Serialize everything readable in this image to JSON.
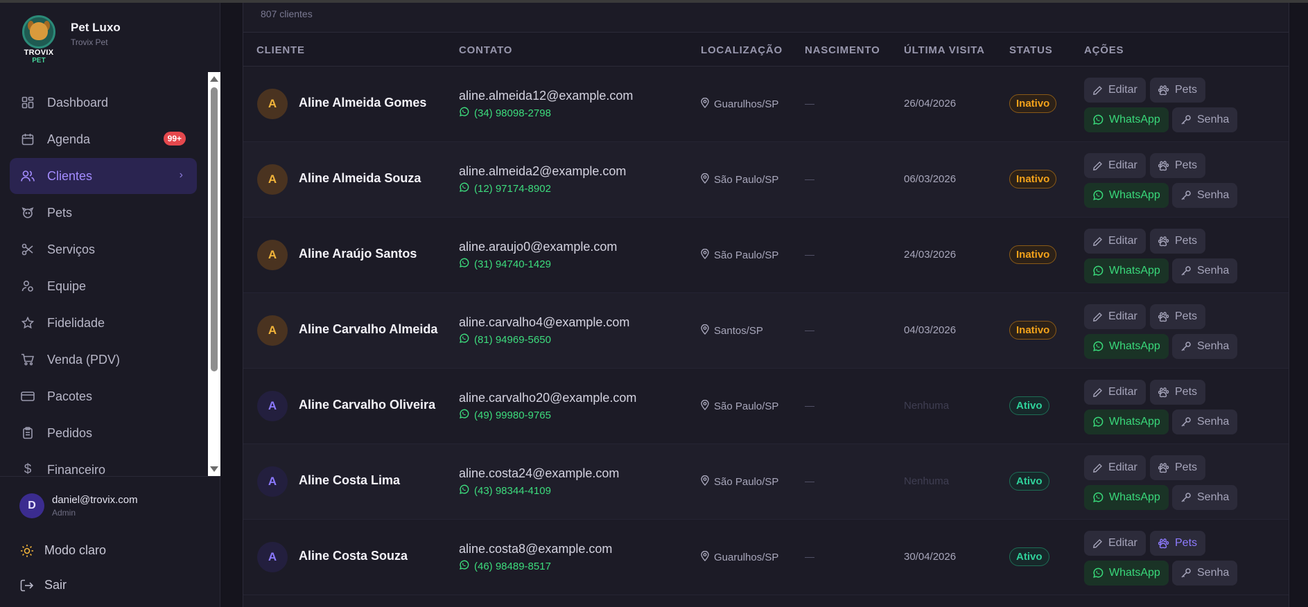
{
  "brand": {
    "name": "Pet Luxo",
    "subtitle": "Trovix Pet",
    "logo_text_1": "TROVIX",
    "logo_text_2": "PET"
  },
  "sidebar": {
    "items": [
      {
        "label": "Dashboard",
        "icon": "dashboard-icon"
      },
      {
        "label": "Agenda",
        "icon": "calendar-icon",
        "badge": "99+"
      },
      {
        "label": "Clientes",
        "icon": "users-icon",
        "active": true
      },
      {
        "label": "Pets",
        "icon": "dog-icon"
      },
      {
        "label": "Serviços",
        "icon": "scissors-icon"
      },
      {
        "label": "Equipe",
        "icon": "team-icon"
      },
      {
        "label": "Fidelidade",
        "icon": "star-icon"
      },
      {
        "label": "Venda (PDV)",
        "icon": "cart-icon"
      },
      {
        "label": "Pacotes",
        "icon": "card-icon"
      },
      {
        "label": "Pedidos",
        "icon": "clipboard-icon"
      },
      {
        "label": "Financeiro",
        "icon": "dollar-icon"
      }
    ]
  },
  "user": {
    "initial": "D",
    "email": "daniel@trovix.com",
    "role": "Admin"
  },
  "footer": {
    "theme_label": "Modo claro",
    "logout_label": "Sair"
  },
  "main": {
    "count_label": "807 clientes",
    "columns": [
      "CLIENTE",
      "CONTATO",
      "LOCALIZAÇÃO",
      "NASCIMENTO",
      "ÚLTIMA VISITA",
      "STATUS",
      "AÇÕES"
    ],
    "actions": {
      "edit": "Editar",
      "pets": "Pets",
      "whatsapp": "WhatsApp",
      "password": "Senha"
    },
    "rows": [
      {
        "initial": "A",
        "name": "Aline Almeida Gomes",
        "email": "aline.almeida12@example.com",
        "phone": "(34) 98098-2798",
        "location": "Guarulhos/SP",
        "birth": "—",
        "last_visit": "26/04/2026",
        "status": "Inativo"
      },
      {
        "initial": "A",
        "name": "Aline Almeida Souza",
        "email": "aline.almeida2@example.com",
        "phone": "(12) 97174-8902",
        "location": "São Paulo/SP",
        "birth": "—",
        "last_visit": "06/03/2026",
        "status": "Inativo"
      },
      {
        "initial": "A",
        "name": "Aline Araújo Santos",
        "email": "aline.araujo0@example.com",
        "phone": "(31) 94740-1429",
        "location": "São Paulo/SP",
        "birth": "—",
        "last_visit": "24/03/2026",
        "status": "Inativo"
      },
      {
        "initial": "A",
        "name": "Aline Carvalho Almeida",
        "email": "aline.carvalho4@example.com",
        "phone": "(81) 94969-5650",
        "location": "Santos/SP",
        "birth": "—",
        "last_visit": "04/03/2026",
        "status": "Inativo"
      },
      {
        "initial": "A",
        "name": "Aline Carvalho Oliveira",
        "email": "aline.carvalho20@example.com",
        "phone": "(49) 99980-9765",
        "location": "São Paulo/SP",
        "birth": "—",
        "last_visit": "Nenhuma",
        "status": "Ativo"
      },
      {
        "initial": "A",
        "name": "Aline Costa Lima",
        "email": "aline.costa24@example.com",
        "phone": "(43) 98344-4109",
        "location": "São Paulo/SP",
        "birth": "—",
        "last_visit": "Nenhuma",
        "status": "Ativo"
      },
      {
        "initial": "A",
        "name": "Aline Costa Souza",
        "email": "aline.costa8@example.com",
        "phone": "(46) 98489-8517",
        "location": "Guarulhos/SP",
        "birth": "—",
        "last_visit": "30/04/2026",
        "status": "Ativo"
      }
    ]
  },
  "colors": {
    "accent": "#8e7bff",
    "inactive": "#f3a21b",
    "active": "#2fd19a",
    "whatsapp": "#39d87a",
    "badge": "#e5484d"
  }
}
